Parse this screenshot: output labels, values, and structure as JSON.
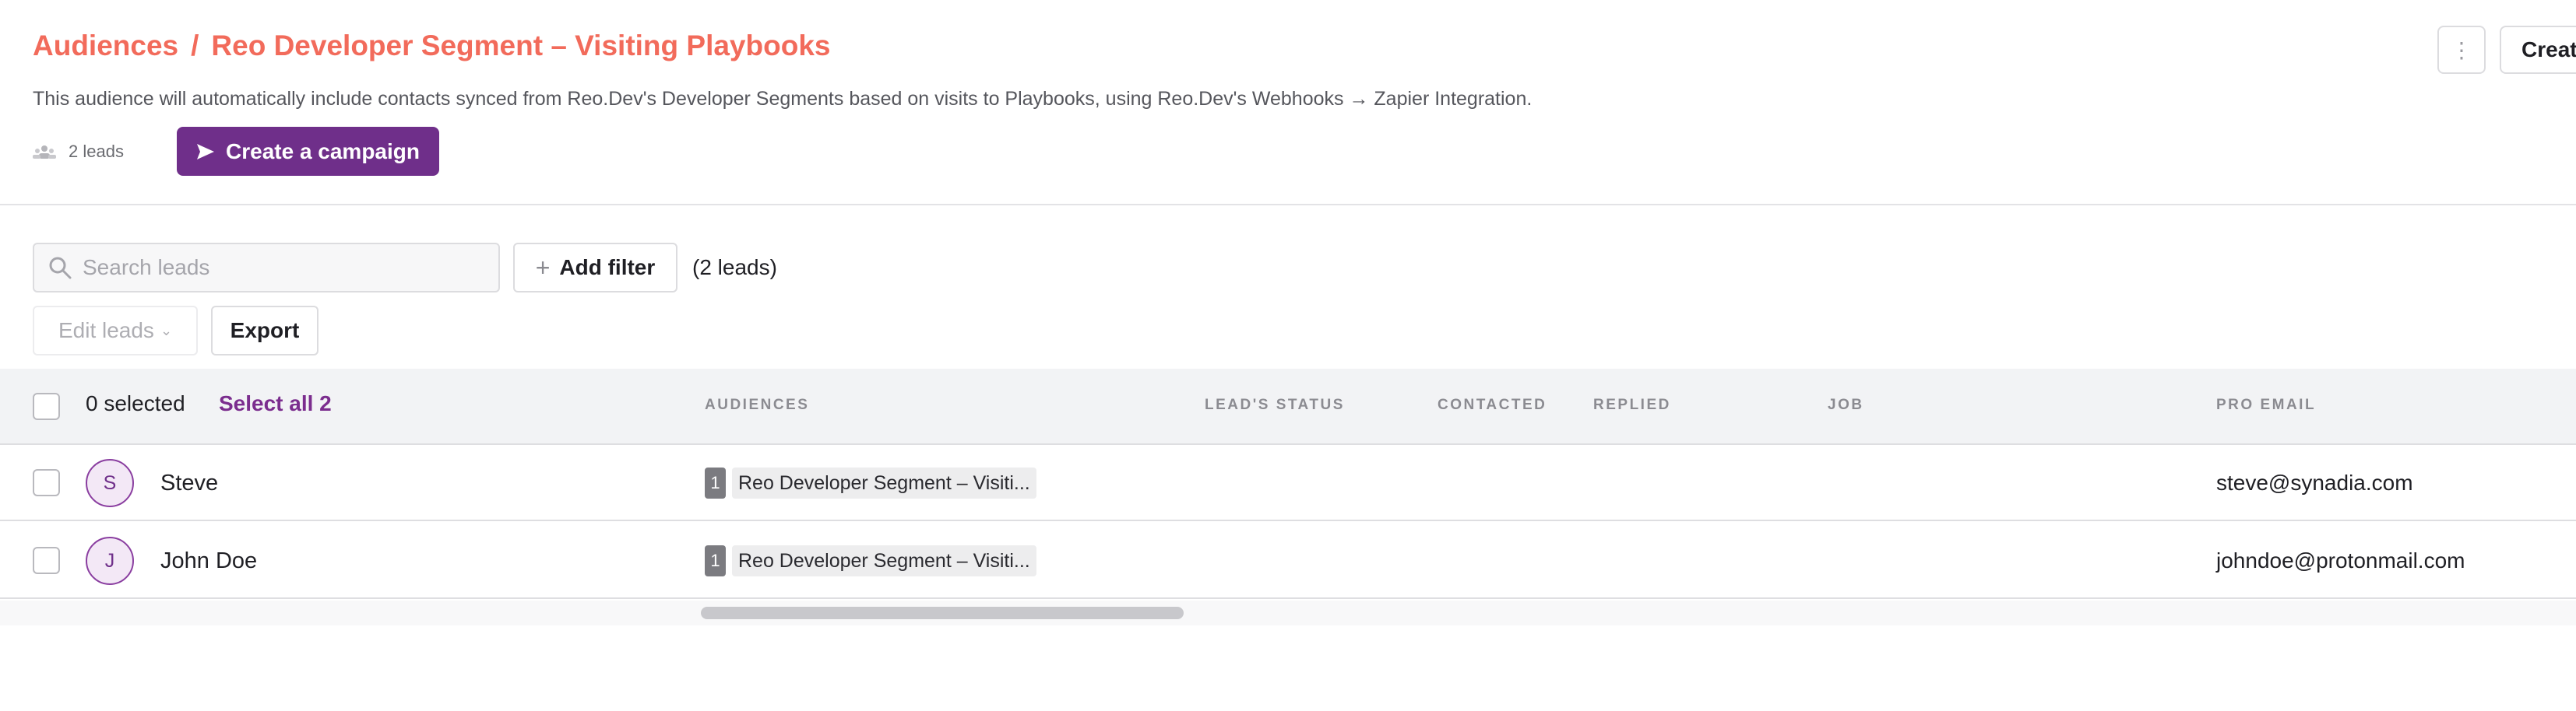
{
  "header": {
    "breadcrumb_root": "Audiences",
    "breadcrumb_sep": "/",
    "breadcrumb_current": "Reo Developer Segment – Visiting Playbooks",
    "description": "This audience will automatically include contacts synced from Reo.Dev's Developer Segments based on visits to Playbooks, using Reo.Dev's Webhooks → Zapier Integration.",
    "leads_count": "2 leads",
    "create_campaign_label": "Create a campaign",
    "more_label": "⋮",
    "create_label": "Create"
  },
  "toolbar": {
    "search_placeholder": "Search leads",
    "add_filter_label": "Add filter",
    "filter_count": "(2 leads)",
    "edit_leads_label": "Edit leads",
    "export_label": "Export"
  },
  "table": {
    "selected_label": "0 selected",
    "select_all_label": "Select all 2",
    "columns": {
      "audiences": "AUDIENCES",
      "status": "LEAD'S STATUS",
      "contacted": "CONTACTED",
      "replied": "REPLIED",
      "job": "JOB",
      "pro_email": "PRO EMAIL"
    },
    "rows": [
      {
        "initial": "S",
        "name": "Steve",
        "audience_count": "1",
        "audience_label": "Reo Developer Segment – Visiti...",
        "email": "steve@synadia.com"
      },
      {
        "initial": "J",
        "name": "John Doe",
        "audience_count": "1",
        "audience_label": "Reo Developer Segment – Visiti...",
        "email": "johndoe@protonmail.com"
      }
    ]
  },
  "colors": {
    "accent_purple": "#6f2f8a",
    "breadcrumb_coral": "#f26b5b"
  }
}
